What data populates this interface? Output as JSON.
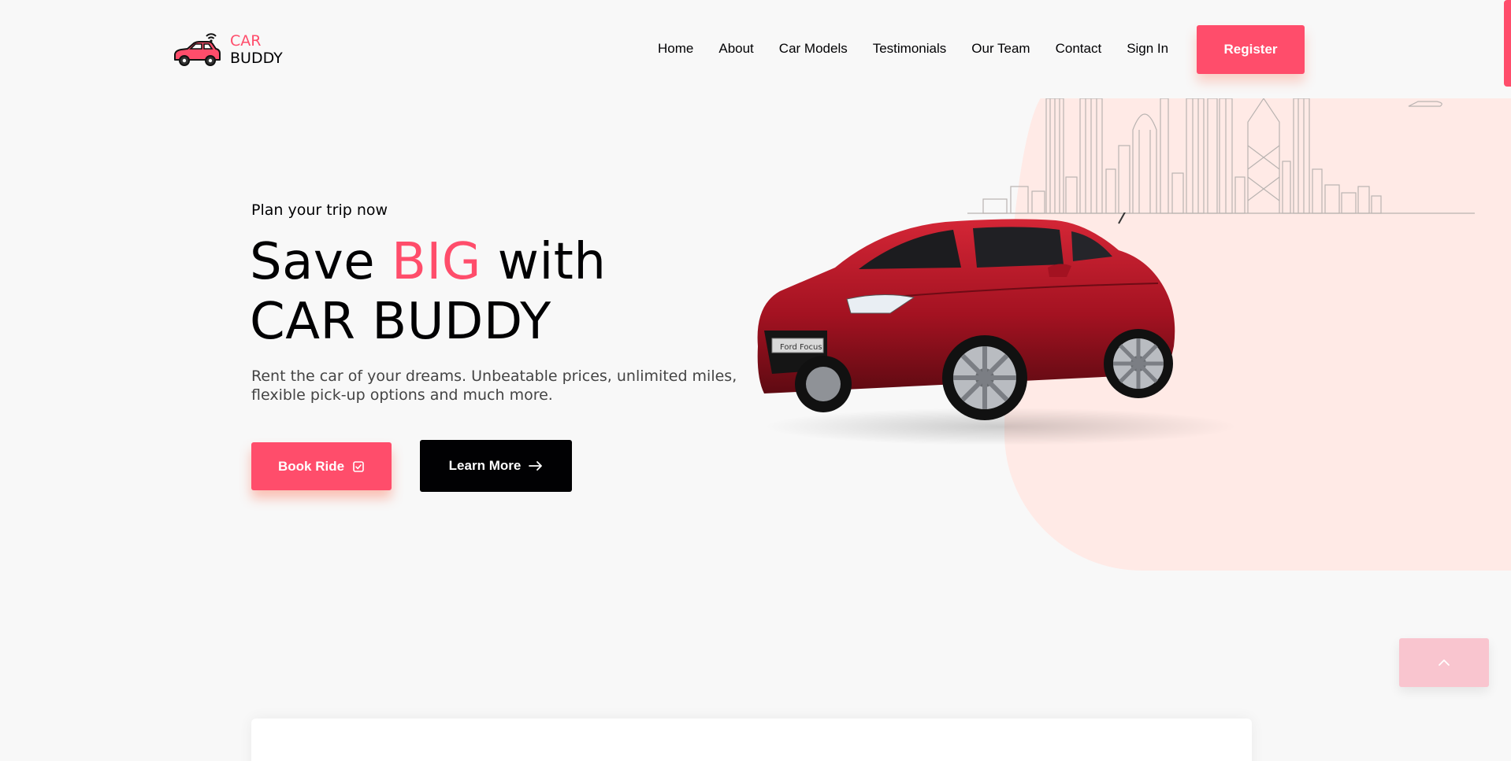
{
  "brand": {
    "line1": "CAR",
    "line2": "BUDDY",
    "icon": "car-wifi-icon"
  },
  "nav": {
    "items": [
      {
        "label": "Home"
      },
      {
        "label": "About"
      },
      {
        "label": "Car Models"
      },
      {
        "label": "Testimonials"
      },
      {
        "label": "Our Team"
      },
      {
        "label": "Contact"
      },
      {
        "label": "Sign In"
      }
    ],
    "register_label": "Register"
  },
  "hero": {
    "kicker": "Plan your trip now",
    "title_part1": "Save ",
    "title_accent": "BIG",
    "title_part2": " with",
    "title_line2": "CAR BUDDY",
    "description": "Rent the car of your dreams. Unbeatable prices, unlimited miles, flexible pick-up options and much more.",
    "book_label": "Book Ride",
    "book_icon": "check-square-icon",
    "learn_label": "Learn More",
    "learn_icon": "arrow-right-icon",
    "car_plate": "Ford Focus"
  },
  "colors": {
    "accent": "#ff4d6b",
    "dark": "#010103",
    "background": "#f8f8f8",
    "hero_blob": "#ffeae6",
    "scroll_up": "#f9c5cf"
  },
  "scroll_up_icon": "chevron-up-icon"
}
